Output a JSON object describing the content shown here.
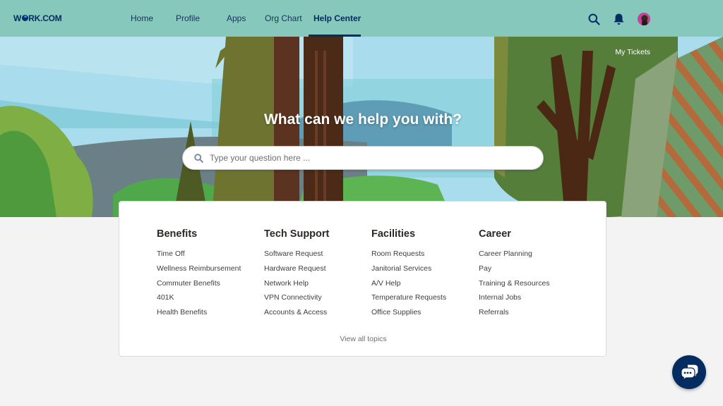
{
  "header": {
    "logo": {
      "prefix": "W",
      "suffix": "RK.COM"
    },
    "nav": [
      {
        "label": "Home",
        "active": false
      },
      {
        "label": "Profile",
        "active": false
      },
      {
        "label": "Apps",
        "active": false
      },
      {
        "label": "Org Chart",
        "active": false
      },
      {
        "label": "Help Center",
        "active": true
      }
    ],
    "icons": {
      "search": "search-icon",
      "notifications": "bell-icon",
      "avatar": "user-avatar"
    }
  },
  "hero": {
    "my_tickets": "My Tickets",
    "title": "What can we help you with?",
    "search_placeholder": "Type your question here ..."
  },
  "topics": {
    "columns": [
      {
        "title": "Benefits",
        "items": [
          "Time Off",
          "Wellness Reimbursement",
          "Commuter Benefits",
          "401K",
          "Health Benefits"
        ]
      },
      {
        "title": "Tech Support",
        "items": [
          "Software Request",
          "Hardware Request",
          "Network Help",
          "VPN Connectivity",
          "Accounts & Access"
        ]
      },
      {
        "title": "Facilities",
        "items": [
          "Room Requests",
          "Janitorial Services",
          "A/V Help",
          "Temperature Requests",
          "Office Supplies"
        ]
      },
      {
        "title": "Career",
        "items": [
          "Career Planning",
          "Pay",
          "Training & Resources",
          "Internal Jobs",
          "Referrals"
        ]
      }
    ],
    "view_all": "View all topics"
  },
  "chat_button": {
    "icon": "chat-bubbles-icon"
  },
  "colors": {
    "header_bg": "#86c8bc",
    "brand_navy": "#032d60",
    "page_bg": "#f3f3f3"
  }
}
